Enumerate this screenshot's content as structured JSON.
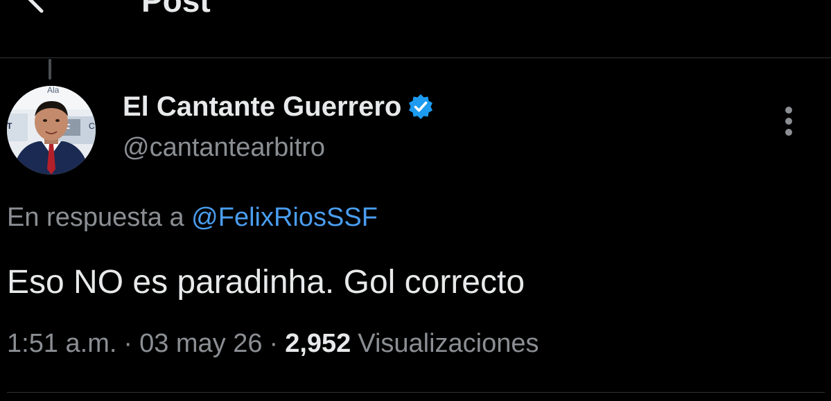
{
  "topbar": {
    "title": "Post"
  },
  "author": {
    "display_name": "El Cantante Guerrero",
    "handle": "@cantantearbitro",
    "verified": true
  },
  "reply": {
    "prefix": "En respuesta a",
    "mention": "@FelixRiosSSF"
  },
  "post": {
    "text": "Eso NO es paradinha. Gol correcto"
  },
  "meta": {
    "time": "1:51 a.m.",
    "separator": "·",
    "date": "03 may 26",
    "views_count": "2,952",
    "views_label": "Visualizaciones"
  },
  "avatar_sign_text": {
    "top": "Ala",
    "left": "T",
    "mid": "IF",
    "right": "C"
  },
  "colors": {
    "background": "#000000",
    "text_primary": "#e7e9ea",
    "text_secondary": "#8b8f94",
    "link": "#4a9df0",
    "verified": "#1d9bf0",
    "divider": "#2f3336"
  },
  "icons": [
    "back-arrow-icon",
    "verified-badge-icon",
    "more-options-icon"
  ]
}
